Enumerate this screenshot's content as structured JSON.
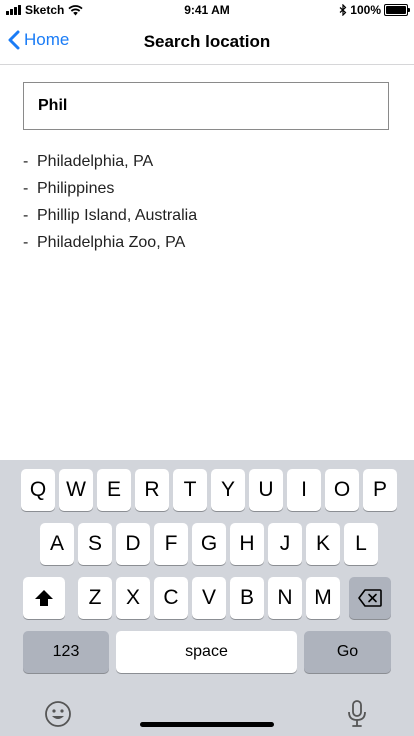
{
  "status_bar": {
    "carrier": "Sketch",
    "time": "9:41 AM",
    "battery": "100%",
    "battery_level": 1.0
  },
  "nav": {
    "back_label": "Home",
    "title": "Search location"
  },
  "search": {
    "value": "Phil"
  },
  "results": [
    "Philadelphia, PA",
    "Philippines",
    "Phillip Island, Australia",
    "Philadelphia Zoo, PA"
  ],
  "keyboard": {
    "row1": [
      "Q",
      "W",
      "E",
      "R",
      "T",
      "Y",
      "U",
      "I",
      "O",
      "P"
    ],
    "row2": [
      "A",
      "S",
      "D",
      "F",
      "G",
      "H",
      "J",
      "K",
      "L"
    ],
    "row3": [
      "Z",
      "X",
      "C",
      "V",
      "B",
      "N",
      "M"
    ],
    "numbers_label": "123",
    "space_label": "space",
    "go_label": "Go"
  },
  "icons": {
    "shift": "shift-icon",
    "backspace": "backspace-icon",
    "emoji": "emoji-icon",
    "mic": "microphone-icon"
  },
  "colors": {
    "accent": "#1a7cf6",
    "keyboard_bg": "#d2d5db",
    "key_dark": "#aeb3bd"
  }
}
